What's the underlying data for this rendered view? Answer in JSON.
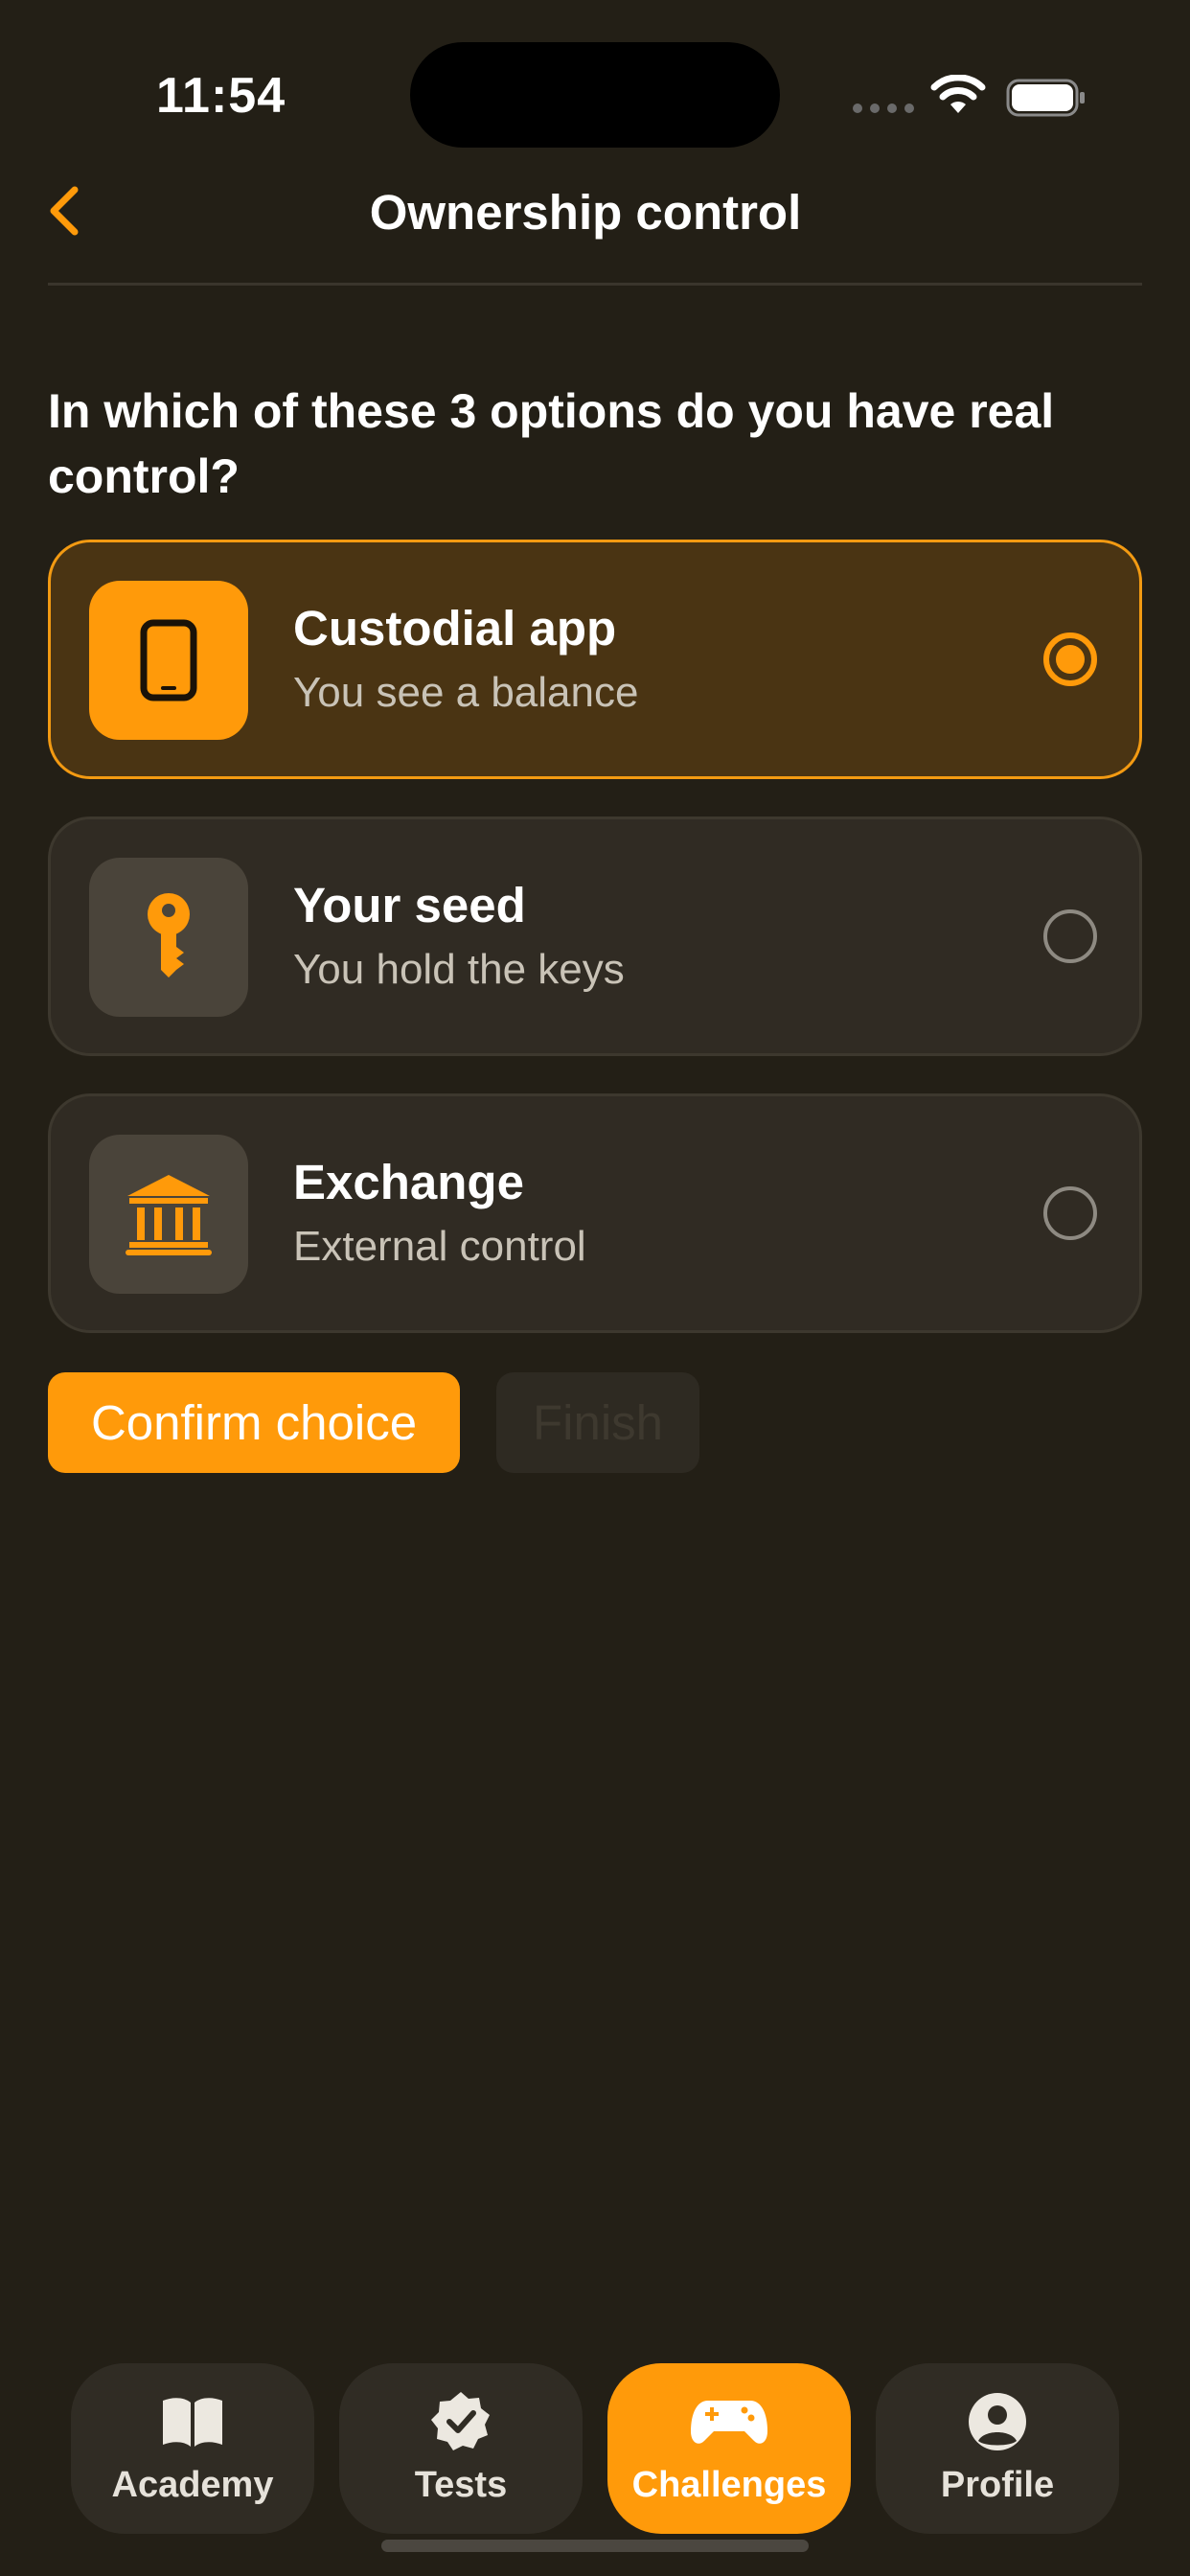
{
  "status_bar": {
    "time": "11:54"
  },
  "nav": {
    "title": "Ownership control"
  },
  "question": "In which of these 3 options do you have real control?",
  "options": [
    {
      "title": "Custodial app",
      "subtitle": "You see a balance",
      "icon": "phone-icon",
      "selected": true
    },
    {
      "title": "Your seed",
      "subtitle": "You hold the keys",
      "icon": "key-icon",
      "selected": false
    },
    {
      "title": "Exchange",
      "subtitle": "External control",
      "icon": "bank-icon",
      "selected": false
    }
  ],
  "buttons": {
    "confirm": "Confirm choice",
    "finish": "Finish"
  },
  "tabs": [
    {
      "label": "Academy",
      "icon": "book-icon",
      "active": false
    },
    {
      "label": "Tests",
      "icon": "checkmark-badge-icon",
      "active": false
    },
    {
      "label": "Challenges",
      "icon": "gamepad-icon",
      "active": true
    },
    {
      "label": "Profile",
      "icon": "person-circle-icon",
      "active": false
    }
  ],
  "colors": {
    "accent": "#ff9a0a",
    "background": "#231f16",
    "card": "#302b23",
    "selected_card": "#4a3413"
  }
}
